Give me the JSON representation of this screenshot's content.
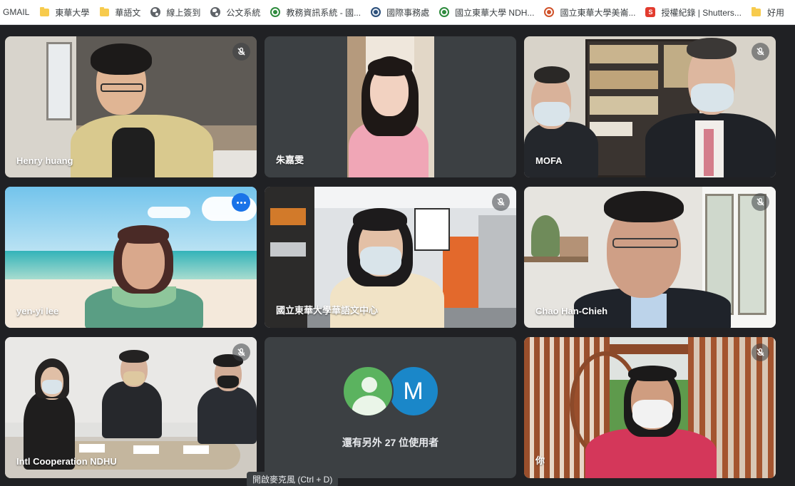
{
  "bookmarks": [
    {
      "label": "GMAIL",
      "icon": "none"
    },
    {
      "label": "東華大學",
      "icon": "folder-icon"
    },
    {
      "label": "華語文",
      "icon": "folder-icon"
    },
    {
      "label": "線上簽到",
      "icon": "globe-icon"
    },
    {
      "label": "公文系統",
      "icon": "globe-icon"
    },
    {
      "label": "教務資訊系統 - 國...",
      "icon": "ndhu-seal-icon"
    },
    {
      "label": "國際事務處",
      "icon": "intl-seal-icon"
    },
    {
      "label": "國立東華大學 NDH...",
      "icon": "ndhu-seal-icon"
    },
    {
      "label": "國立東華大學美崙...",
      "icon": "red-seal-icon"
    },
    {
      "label": "授權紀錄 | Shutters...",
      "icon": "shutterstock-icon"
    },
    {
      "label": "好用",
      "icon": "folder-icon"
    }
  ],
  "participants": [
    {
      "name": "Henry huang",
      "muted": true
    },
    {
      "name": "朱嘉雯",
      "muted": false
    },
    {
      "name": "MOFA",
      "muted": true
    },
    {
      "name": "yen-yi lee",
      "muted": false,
      "active_speaker": true
    },
    {
      "name": "國立東華大學華語文中心",
      "muted": true
    },
    {
      "name": "Chao Han-Chieh",
      "muted": true
    },
    {
      "name": "Intl Cooperation NDHU",
      "muted": true
    },
    {
      "name": "你",
      "muted": true
    }
  ],
  "others": {
    "avatar_letter": "M",
    "text": "還有另外 27 位使用者"
  },
  "tooltip": "開啟麥克風 (Ctrl + D)",
  "colors": {
    "accent": "#1a73e8",
    "active_outline": "#8ab4f8",
    "tile_bg": "#3c4043",
    "page_bg": "#202124"
  }
}
